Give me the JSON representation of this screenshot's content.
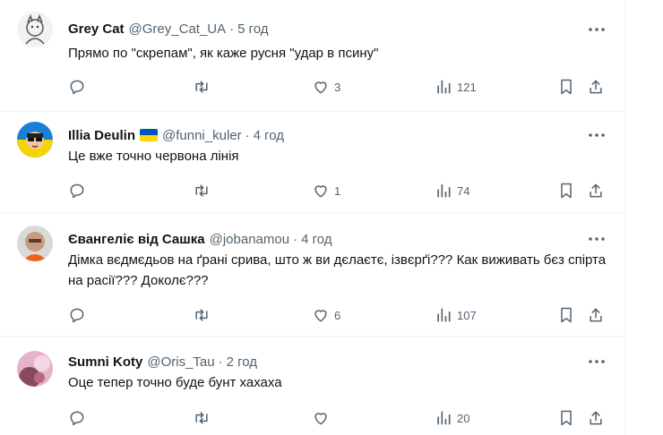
{
  "tweets": [
    {
      "name": "Grey Cat",
      "handle": "@Grey_Cat_UA",
      "dot": "·",
      "time": "5 год",
      "text": "Прямо по \"скрепам\", як каже русня \"удар в псину\"",
      "likes": "3",
      "views": "121",
      "flag": false
    },
    {
      "name": "Illia Deulin",
      "handle": "@funni_kuler",
      "dot": "·",
      "time": "4 год",
      "text": "Це вже точно червона лінія",
      "likes": "1",
      "views": "74",
      "flag": true
    },
    {
      "name": "Євангеліє від Сашка",
      "handle": "@jobanamou",
      "dot": "·",
      "time": "4 год",
      "text": "Дімка вєдмєдьов на ґрані срива, што ж ви дєлаєтє, ізвєрґі??? Как виживать бєз спірта на расії??? Доколє???",
      "likes": "6",
      "views": "107",
      "flag": false
    },
    {
      "name": "Sumni Koty",
      "handle": "@Oris_Tau",
      "dot": "·",
      "time": "2 год",
      "text": "Оце тепер точно буде бунт хахаха",
      "likes": "",
      "views": "20",
      "flag": false
    }
  ],
  "icons": {
    "reply": "reply-icon",
    "retweet": "retweet-icon",
    "like": "like-icon",
    "views": "views-icon",
    "bookmark": "bookmark-icon",
    "share": "share-icon",
    "more": "more-icon"
  },
  "colors": {
    "text": "#0f1419",
    "muted": "#536471",
    "border": "#eff3f4"
  }
}
